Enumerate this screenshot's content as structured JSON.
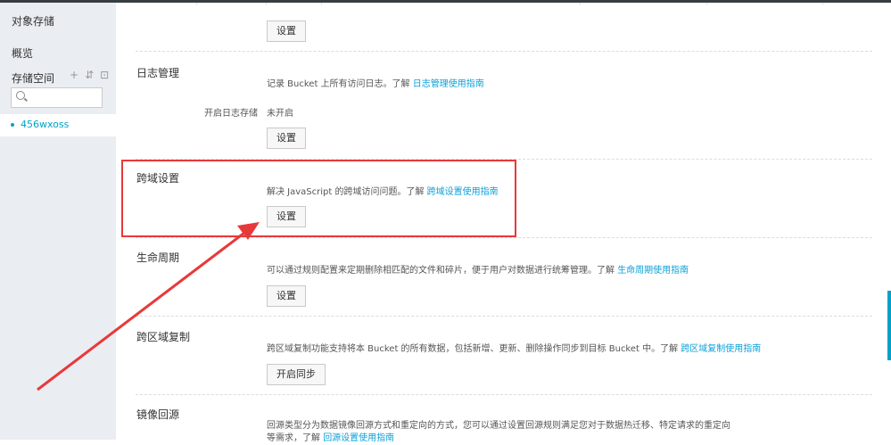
{
  "sidebar": {
    "title": "对象存储",
    "overview": "概览",
    "storage_label": "存储空间",
    "tools": [
      "+",
      "⇵",
      "⊡"
    ],
    "search_placeholder": "",
    "bucket_name": "456wxoss"
  },
  "sections": {
    "top_button": "设置",
    "logging": {
      "title": "日志管理",
      "desc": "记录 Bucket 上所有访问日志。了解",
      "link": "日志管理使用指南",
      "row_label": "开启日志存储",
      "row_value": "未开启",
      "button": "设置"
    },
    "cors": {
      "title": "跨域设置",
      "desc": "解决 JavaScript 的跨域访问问题。了解",
      "link": "跨域设置使用指南",
      "button": "设置"
    },
    "lifecycle": {
      "title": "生命周期",
      "desc": "可以通过规则配置来定期删除相匹配的文件和碎片，便于用户对数据进行统筹管理。了解",
      "link": "生命周期使用指南",
      "button": "设置"
    },
    "replication": {
      "title": "跨区域复制",
      "desc": "跨区域复制功能支持将本 Bucket 的所有数据，包括新增、更新、删除操作同步到目标 Bucket 中。了解",
      "link": "跨区域复制使用指南",
      "button": "开启同步"
    },
    "mirror": {
      "title": "镜像回源",
      "desc": "回源类型分为数据镜像回源方式和重定向的方式，您可以通过设置回源规则满足您对于数据热迁移、特定请求的重定向等需求，了解",
      "link": "回源设置使用指南"
    }
  },
  "colors": {
    "annotation": "#e8393a",
    "link": "#0aa1d8",
    "sidebar_bg": "#eaedf1"
  }
}
